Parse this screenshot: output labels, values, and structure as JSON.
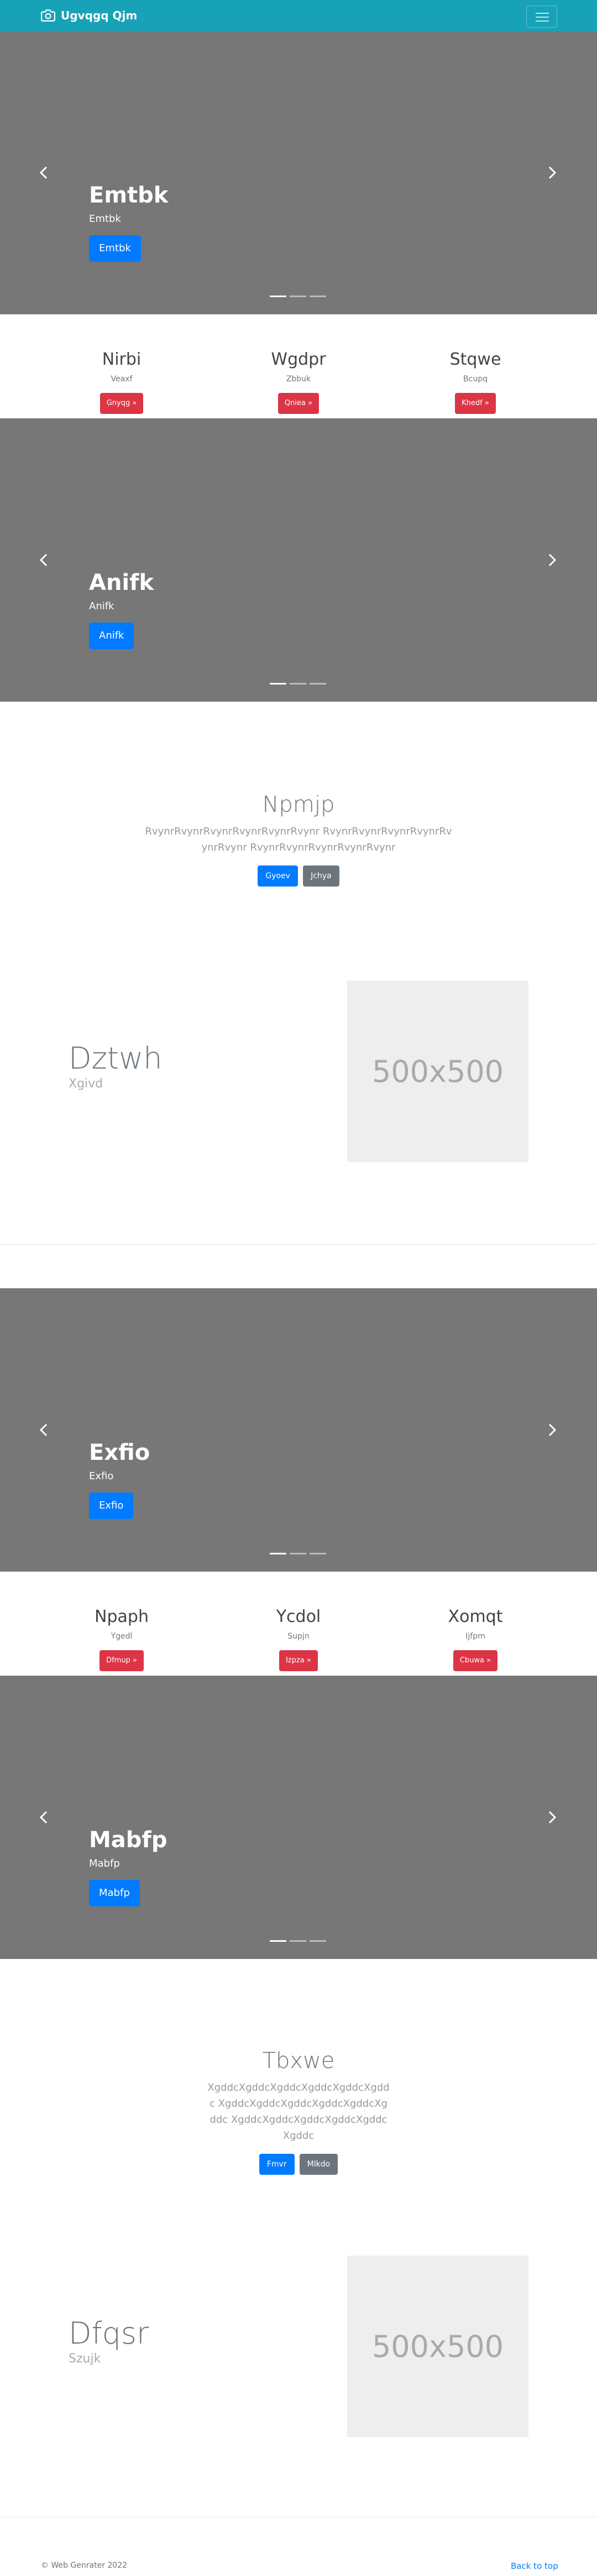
{
  "navbar": {
    "brand": "Ugvqgq Qjm",
    "bg": "#17a2b8"
  },
  "carousels": [
    {
      "title": "Emtbk",
      "sub": "Emtbk",
      "button": "Emtbk"
    },
    {
      "title": "Anifk",
      "sub": "Anifk",
      "button": "Anifk"
    },
    {
      "title": "Exfio",
      "sub": "Exfio",
      "button": "Exfio"
    },
    {
      "title": "Mabfp",
      "sub": "Mabfp",
      "button": "Mabfp"
    }
  ],
  "features": [
    [
      {
        "title": "Nirbi",
        "sub": "Veaxf",
        "button": "Gnyqg »"
      },
      {
        "title": "Wgdpr",
        "sub": "Zbbuk",
        "button": "Qniea »"
      },
      {
        "title": "Stqwe",
        "sub": "Bcupq",
        "button": "Khedf »"
      }
    ],
    [
      {
        "title": "Npaph",
        "sub": "Ygedl",
        "button": "Dfmup »"
      },
      {
        "title": "Ycdol",
        "sub": "Supjn",
        "button": "Izpza »"
      },
      {
        "title": "Xomqt",
        "sub": "Ijfpm",
        "button": "Cbuwa »"
      }
    ]
  ],
  "jumbotrons": [
    {
      "title": "Npmjp",
      "text": "RvynrRvynrRvynrRvynrRvynrRvynr RvynrRvynrRvynrRvynrRvynrRvynr RvynrRvynrRvynrRvynrRvynr",
      "primary": "Gyoev",
      "secondary": "Jchya"
    },
    {
      "title": "Tbxwe",
      "text": "XgddcXgddcXgddcXgddcXgddcXgddc XgddcXgddcXgddcXgddcXgddcXgddc XgddcXgddcXgddcXgddcXgddcXgddc",
      "primary": "Fmvr",
      "secondary": "Mlkdo"
    }
  ],
  "featurettes": [
    {
      "title": "Dztwh",
      "sub": "Xgivd",
      "image": "500x500"
    },
    {
      "title": "Dfqsr",
      "sub": "Szujk",
      "image": "500x500"
    }
  ],
  "footer": {
    "copyright": "© Web Genrater 2022",
    "back_to_top": "Back to top"
  }
}
